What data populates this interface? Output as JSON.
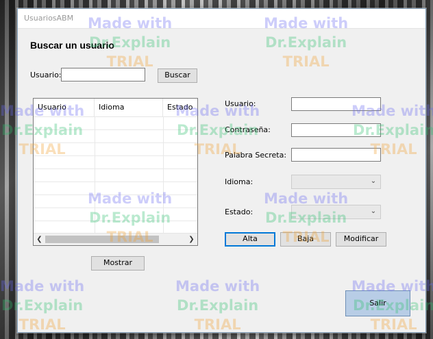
{
  "window": {
    "title": "UsuariosABM"
  },
  "search": {
    "heading": "Buscar un usuario",
    "usuario_label": "Usuario:",
    "usuario_value": "",
    "buscar_label": "Buscar"
  },
  "grid": {
    "columns": [
      "Usuario",
      "Idioma",
      "Estado"
    ],
    "rows": []
  },
  "form": {
    "usuario_label": "Usuario:",
    "usuario_value": "",
    "contrasena_label": "Contraseña:",
    "contrasena_value": "",
    "palabra_label": "Palabra Secreta:",
    "palabra_value": "",
    "idioma_label": "Idioma:",
    "idioma_value": "",
    "estado_label": "Estado:",
    "estado_value": ""
  },
  "actions": {
    "alta_label": "Alta",
    "baja_label": "Baja",
    "modificar_label": "Modificar",
    "mostrar_label": "Mostrar",
    "salir_label": "Salir"
  },
  "scrollbar": {
    "left_icon": "chevron-left-icon",
    "right_icon": "chevron-right-icon"
  },
  "watermark": {
    "line1": "Made with",
    "line2": "Dr.Explain",
    "line3": "TRIAL"
  },
  "colors": {
    "accent": "#0078d7",
    "salir_button": "#b8cde6"
  }
}
